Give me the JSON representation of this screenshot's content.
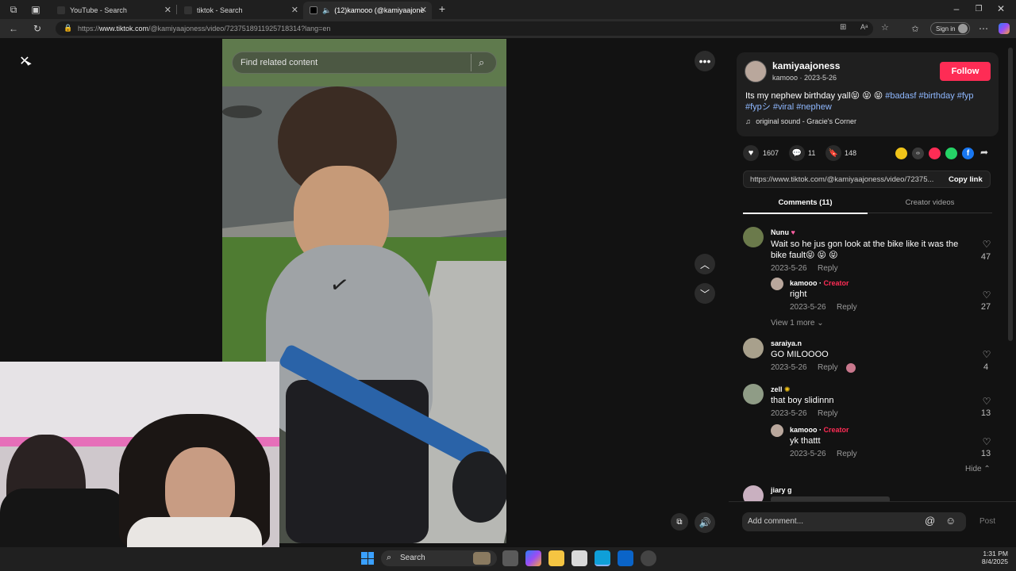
{
  "browser": {
    "tabs": [
      {
        "title": "YouTube - Search"
      },
      {
        "title": "tiktok - Search"
      },
      {
        "title": "(12)kamooo (@kamiyaajonе"
      }
    ],
    "url_prefix": "https://",
    "url_domain": "www.tiktok.com",
    "url_path": "/@kamiyaajoness/video/7237518911925718314?lang=en",
    "signin_label": "Sign in"
  },
  "video": {
    "search_placeholder": "Find related content"
  },
  "post": {
    "username": "kamiyaajoness",
    "nickname_date": "kamooo · 2023-5-26",
    "follow_label": "Follow",
    "caption_text": "Its my nephew birthday yall😝 😝 😝",
    "hashtags_line1": "#badasf #birthday #fyp",
    "hashtags_line2": "#fypシ #viral #nephew",
    "sound": "original sound - Gracie's Corner",
    "likes": "1607",
    "comments": "11",
    "saves": "148",
    "share_url": "https://www.tiktok.com/@kamiyaajoness/video/72375...",
    "copy_link_label": "Copy link"
  },
  "tabs": {
    "comments_label": "Comments (11)",
    "creator_label": "Creator videos"
  },
  "comments": [
    {
      "user": "Nunu",
      "text1": "Wait so he jus gon look at the bike like it was the",
      "text2": "bike fault😝 😝 😝",
      "date": "2023-5-26",
      "reply": "Reply",
      "likes": "47"
    },
    {
      "user": "kamooo",
      "creator_tag": "Creator",
      "text1": "right",
      "date": "2023-5-26",
      "reply": "Reply",
      "likes": "27"
    },
    {
      "user": "saraiya.n",
      "text1": "GO MILOOOO",
      "date": "2023-5-26",
      "reply": "Reply",
      "likes": "4"
    },
    {
      "user": "zell",
      "text1": "that boy slidinnn",
      "date": "2023-5-26",
      "reply": "Reply",
      "likes": "13"
    },
    {
      "user": "kamooo",
      "creator_tag": "Creator",
      "text1": "yk thattt",
      "date": "2023-5-26",
      "reply": "Reply",
      "likes": "13"
    },
    {
      "user": "jiary g"
    }
  ],
  "view_more_label": "View 1 more",
  "hide_label": "Hide",
  "add_comment_placeholder": "Add comment...",
  "post_label": "Post",
  "taskbar": {
    "search_label": "Search",
    "time": "1:31 PM",
    "date": "8/4/2025"
  },
  "colors": {
    "accent": "#fe2c55",
    "hashtag": "#8fb8ff",
    "creator": "#fe2c55"
  }
}
